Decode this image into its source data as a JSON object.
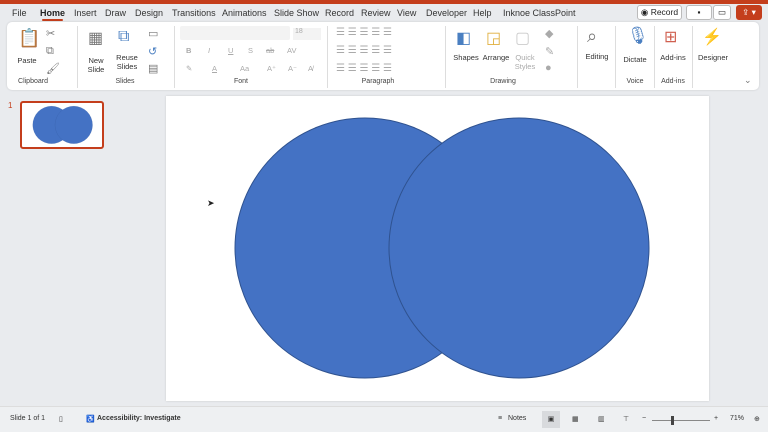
{
  "menu_tabs": [
    "File",
    "Home",
    "Insert",
    "Draw",
    "Design",
    "Transitions",
    "Animations",
    "Slide Show",
    "Record",
    "Review",
    "View",
    "Developer",
    "Help",
    "Inknoe ClassPoint"
  ],
  "active_tab": "Home",
  "top_buttons": {
    "record": "Record"
  },
  "ribbon": {
    "clipboard": {
      "paste": "Paste",
      "group": "Clipboard"
    },
    "slides": {
      "new_slide": "New Slide",
      "reuse": "Reuse Slides",
      "group": "Slides"
    },
    "font": {
      "size": "18",
      "group": "Font",
      "bold": "B",
      "italic": "I",
      "underline": "U",
      "strike": "S"
    },
    "paragraph": {
      "group": "Paragraph"
    },
    "drawing": {
      "shapes": "Shapes",
      "arrange": "Arrange",
      "quick_styles": "Quick Styles",
      "group": "Drawing"
    },
    "editing": {
      "label": "Editing"
    },
    "voice": {
      "dictate": "Dictate",
      "group": "Voice"
    },
    "addins": {
      "label": "Add-ins",
      "group": "Add-ins"
    },
    "designer": {
      "label": "Designer"
    }
  },
  "slide_panel": {
    "number": "1"
  },
  "slide": {
    "shape_fill": "#4472C4",
    "shape_stroke": "#2F528F"
  },
  "accent": "#C43E1C",
  "status": {
    "slide": "Slide 1 of 1",
    "accessibility": "Accessibility: Investigate",
    "notes": "Notes",
    "zoom": "71%",
    "zoom_level_percent": 71
  }
}
